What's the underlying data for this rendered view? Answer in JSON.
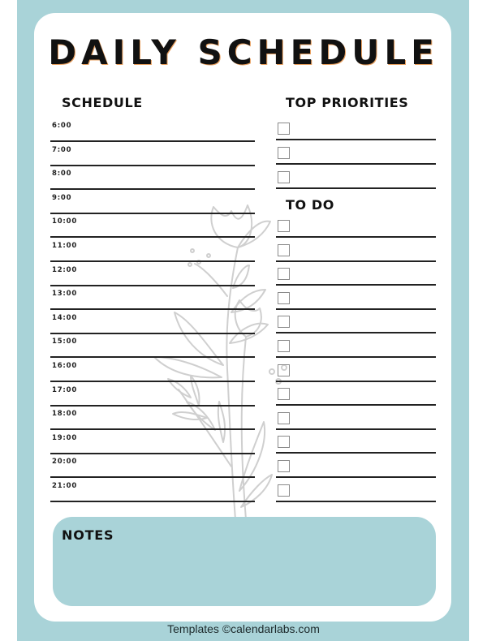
{
  "title": "DAILY SCHEDULE",
  "schedule": {
    "heading": "SCHEDULE",
    "times": [
      "6:00",
      "7:00",
      "8:00",
      "9:00",
      "10:00",
      "11:00",
      "12:00",
      "13:00",
      "14:00",
      "15:00",
      "16:00",
      "17:00",
      "18:00",
      "19:00",
      "20:00",
      "21:00"
    ]
  },
  "priorities": {
    "heading": "TOP PRIORITIES",
    "count": 3
  },
  "todo": {
    "heading": "TO DO",
    "count": 12
  },
  "notes": {
    "heading": "NOTES",
    "value": ""
  },
  "footer": "Templates ©calendarlabs.com",
  "colors": {
    "accent": "#a9d3d8",
    "card": "#ffffff",
    "rule": "#222222",
    "flower": "#cfcfcf"
  }
}
